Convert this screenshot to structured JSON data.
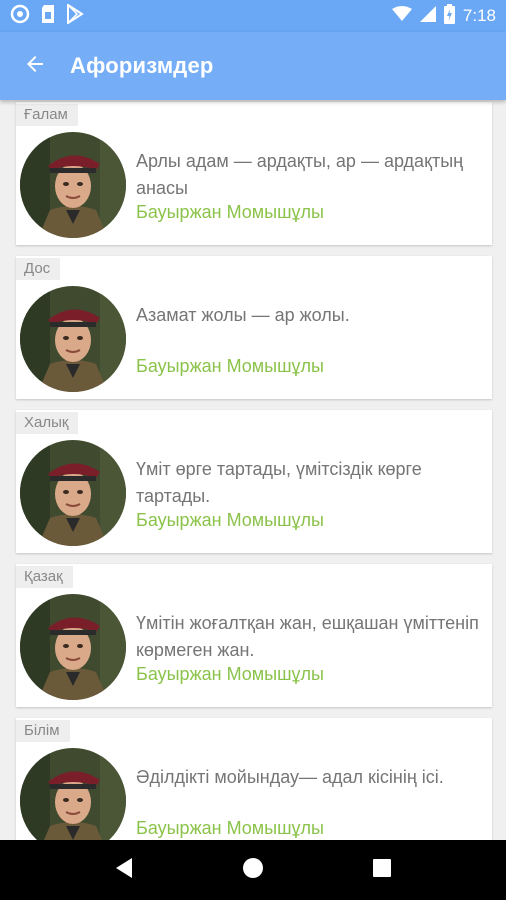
{
  "status_bar": {
    "time": "7:18",
    "left_icons": [
      "circle-icon",
      "sim-card-icon",
      "play-store-icon"
    ],
    "right_icons": [
      "wifi-icon",
      "signal-icon",
      "battery-icon"
    ]
  },
  "app_bar": {
    "title": "Афоризмдер",
    "back_icon": "arrow-back-icon"
  },
  "cards": [
    {
      "category": "Ғалам",
      "quote": "Арлы адам — ардақты, ар — ардақтың анасы",
      "author": "Бауыржан Момышұлы"
    },
    {
      "category": "Дос",
      "quote": "Азамат жолы — ар жолы.",
      "author": "Бауыржан Момышұлы"
    },
    {
      "category": "Халық",
      "quote": "Үміт өрге тартады, үмітсіздік көрге тартады.",
      "author": "Бауыржан Момышұлы"
    },
    {
      "category": "Қазақ",
      "quote": "Үмітін жоғалтқан жан, ешқашан үміттеніп көрмеген жан.",
      "author": "Бауыржан Момышұлы"
    },
    {
      "category": "Білім",
      "quote": "Әділдікті мойындау— адал кісінің ісі.",
      "author": "Бауыржан Момышұлы"
    }
  ],
  "colors": {
    "status_bar": "#6aa8f5",
    "app_bar": "#75aef7",
    "author_green": "#8bc34a",
    "quote_gray": "#757575"
  },
  "nav_bar": {
    "icons": [
      "back-triangle-icon",
      "home-circle-icon",
      "recents-square-icon"
    ]
  }
}
